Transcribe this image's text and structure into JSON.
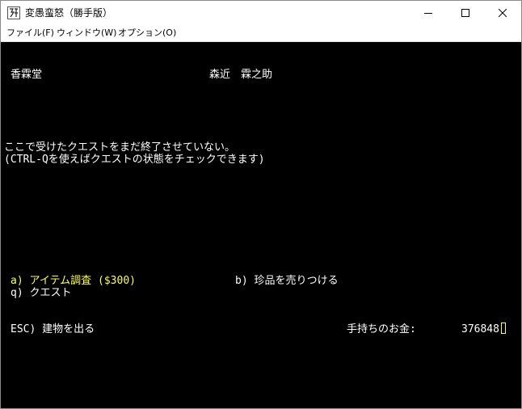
{
  "window": {
    "title": "変愚蛮怒（勝手版）",
    "icon": "app-icon",
    "controls": {
      "minimize": "minimize-icon",
      "maximize": "maximize-icon",
      "close": "close-icon"
    }
  },
  "menubar": {
    "items": [
      {
        "label": "ファイル(F)"
      },
      {
        "label": "ウィンドウ(W)"
      },
      {
        "label": "オプション(O)"
      }
    ]
  },
  "terminal": {
    "shop_name": "香霖堂",
    "owner_name": "森近　霖之助",
    "message_line1": "ここで受けたクエストをまだ終了させていない。",
    "message_line2": "(CTRL-Qを使えばクエストの状態をチェックできます)",
    "options": {
      "a": "a) アイテム調査 ($300)",
      "b": "b) 珍品を売りつける",
      "q": "q) クエスト"
    },
    "exit_label": "ESC) 建物を出る",
    "gold_label": "手持ちのお金:",
    "gold_value": "376848",
    "colors": {
      "background": "#000000",
      "text": "#ffffff",
      "highlight": "#ffff55"
    }
  }
}
